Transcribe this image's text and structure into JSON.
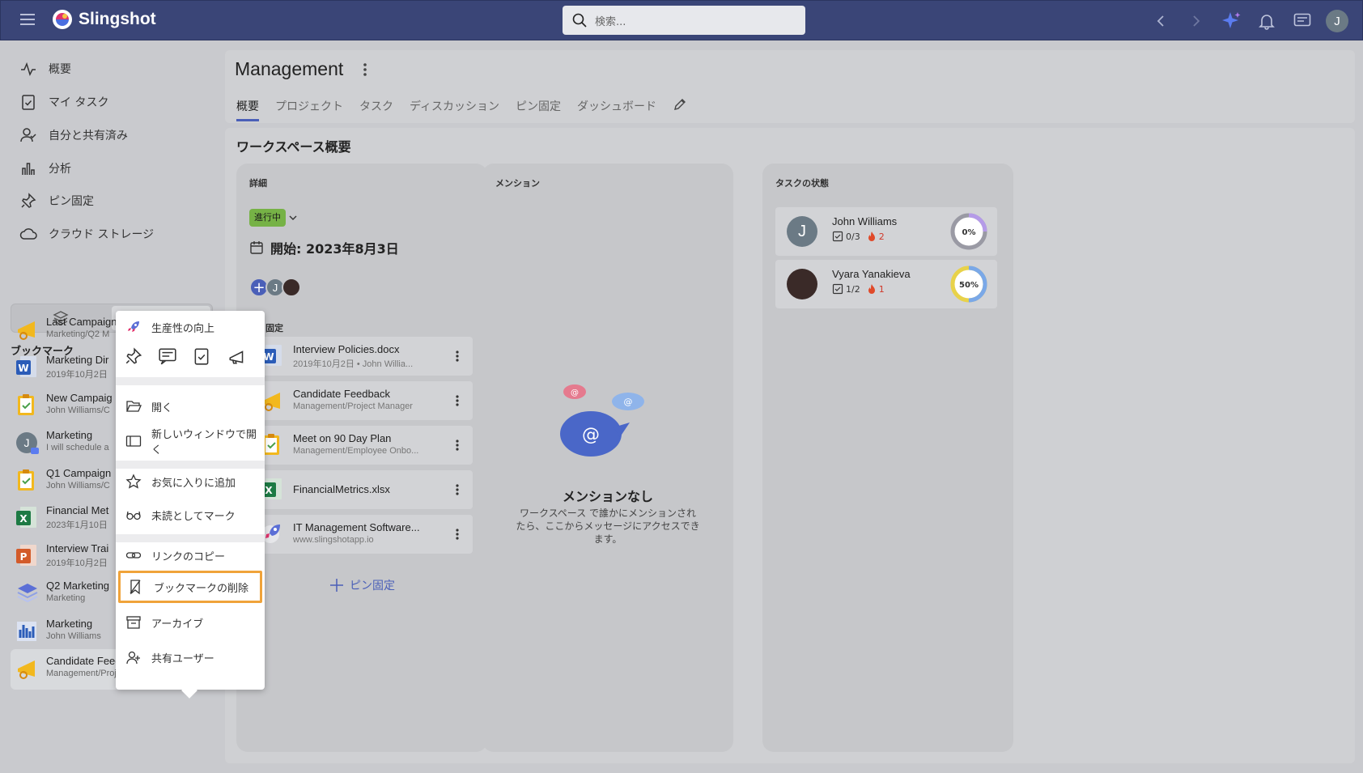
{
  "app": {
    "name": "Slingshot",
    "search_placeholder": "検索...",
    "user_initial": "J"
  },
  "nav": [
    {
      "label": "概要",
      "icon": "activity-icon"
    },
    {
      "label": "マイ タスク",
      "icon": "clipboard-icon"
    },
    {
      "label": "自分と共有済み",
      "icon": "shared-user-icon"
    },
    {
      "label": "分析",
      "icon": "bar-chart-icon"
    },
    {
      "label": "ピン固定",
      "icon": "pin-icon"
    },
    {
      "label": "クラウド ストレージ",
      "icon": "cloud-icon"
    }
  ],
  "bookmarks": {
    "heading": "ブックマーク",
    "items": [
      {
        "title": "Last Campaign",
        "sub": "Marketing/Q2 M",
        "icon": "megaphone-icon"
      },
      {
        "title": "Marketing Dir",
        "sub": "2019年10月2日",
        "icon": "word-icon"
      },
      {
        "title": "New Campaig",
        "sub": "John Williams/C",
        "icon": "task-icon"
      },
      {
        "title": "Marketing",
        "sub": "I will schedule a",
        "icon": "chat-avatar-icon"
      },
      {
        "title": "Q1 Campaign",
        "sub": "John Williams/C",
        "icon": "task-icon"
      },
      {
        "title": "Financial Met",
        "sub": "2023年1月10日",
        "icon": "excel-icon"
      },
      {
        "title": "Interview Trai",
        "sub": "2019年10月2日",
        "icon": "powerpoint-icon"
      },
      {
        "title": "Q2 Marketing",
        "sub": "Marketing",
        "icon": "layers-icon"
      },
      {
        "title": "Marketing",
        "sub": "John Williams",
        "icon": "dashboard-icon"
      },
      {
        "title": "Candidate Feedback",
        "sub": "Management/Project Man...",
        "icon": "megaphone-icon"
      }
    ]
  },
  "workspace": {
    "title": "Management",
    "tabs": [
      "概要",
      "プロジェクト",
      "タスク",
      "ディスカッション",
      "ピン固定",
      "ダッシュボード"
    ],
    "section_title": "ワークスペース概要"
  },
  "details": {
    "heading": "詳細",
    "status": "進行中",
    "start": "開始: 2023年8月3日",
    "pinned_heading": "固定",
    "pinned": [
      {
        "title": "Interview Policies.docx",
        "sub": "2019年10月2日 • John Willia...",
        "icon": "word-icon"
      },
      {
        "title": "Candidate Feedback",
        "sub": "Management/Project Manager",
        "icon": "megaphone-icon"
      },
      {
        "title": "Meet on 90 Day Plan",
        "sub": "Management/Employee Onbo...",
        "icon": "task-icon"
      },
      {
        "title": "FinancialMetrics.xlsx",
        "sub": "",
        "icon": "excel-icon"
      },
      {
        "title": "IT Management Software...",
        "sub": "www.slingshotapp.io",
        "icon": "rocket-icon"
      }
    ],
    "add_pin": "ピン固定"
  },
  "mentions": {
    "heading": "メンション",
    "empty_title": "メンションなし",
    "empty_lines": [
      "ワークスペース で誰かにメンションされ",
      "たら、ここからメッセージにアクセスでき",
      "ます。"
    ]
  },
  "task_status": {
    "heading": "タスクの状態",
    "people": [
      {
        "name": "John Williams",
        "done": "0/3",
        "hot": "2",
        "percent": "0%",
        "fraction": 0
      },
      {
        "name": "Vyara Yanakieva",
        "done": "1/2",
        "hot": "1",
        "percent": "50%",
        "fraction": 0.5
      }
    ]
  },
  "context_menu": {
    "header": "生産性の向上",
    "items": [
      "開く",
      "新しいウィンドウで開く",
      "お気に入りに追加",
      "未読としてマーク",
      "リンクのコピー",
      "ブックマークの削除",
      "アーカイブ",
      "共有ユーザー"
    ]
  },
  "colors": {
    "topbar": "#3a4577",
    "accent": "#4a5fb8",
    "highlight": "#f0a33a",
    "status": "#76b246"
  }
}
